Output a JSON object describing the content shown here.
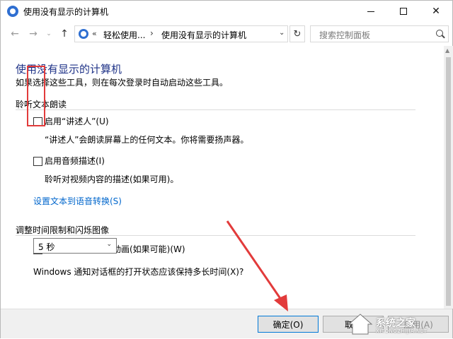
{
  "window": {
    "title": "使用没有显示的计算机"
  },
  "nav": {
    "back_icon": "arrow-left-icon",
    "forward_icon": "arrow-right-icon",
    "history_icon": "chevron-down-icon",
    "up_icon": "arrow-up-icon",
    "address_chevron": "«",
    "breadcrumb": [
      "轻松使用...",
      "使用没有显示的计算机"
    ],
    "crumb_sep": "›",
    "refresh_icon": "refresh-icon",
    "search_placeholder": "搜索控制面板"
  },
  "main": {
    "title": "使用没有显示的计算机",
    "subtitle": "如果选择这些工具，则在每次登录时自动启动这些工具。",
    "section1": {
      "heading": "聆听文本朗读",
      "narrator": {
        "label": "启用“讲述人”(U)",
        "checked": false,
        "description": "“讲述人”会朗读屏幕上的任何文本。你将需要扬声器。"
      },
      "audio_description": {
        "label": "启用音频描述(I)",
        "checked": false,
        "description": "聆听对视频内容的描述(如果可用)。"
      },
      "link": "设置文本到语音转换(S)"
    },
    "section2": {
      "heading": "调整时间限制和闪烁图像",
      "animations": {
        "label": "关闭所有不必要的动画(如果可能)(W)",
        "checked": false
      },
      "notify_question": "Windows 通知对话框的打开状态应该保持多长时间(X)?",
      "notify_selected": "5 秒"
    }
  },
  "footer": {
    "ok": "确定(O)",
    "cancel": "取消",
    "apply": "应用(A)"
  },
  "watermark": {
    "text": "系统之家",
    "sub": "XITONGZHIJIA.NET"
  },
  "colors": {
    "title_blue": "#1e3287",
    "link_blue": "#0066cc",
    "annotation_red": "#e23b3b"
  }
}
